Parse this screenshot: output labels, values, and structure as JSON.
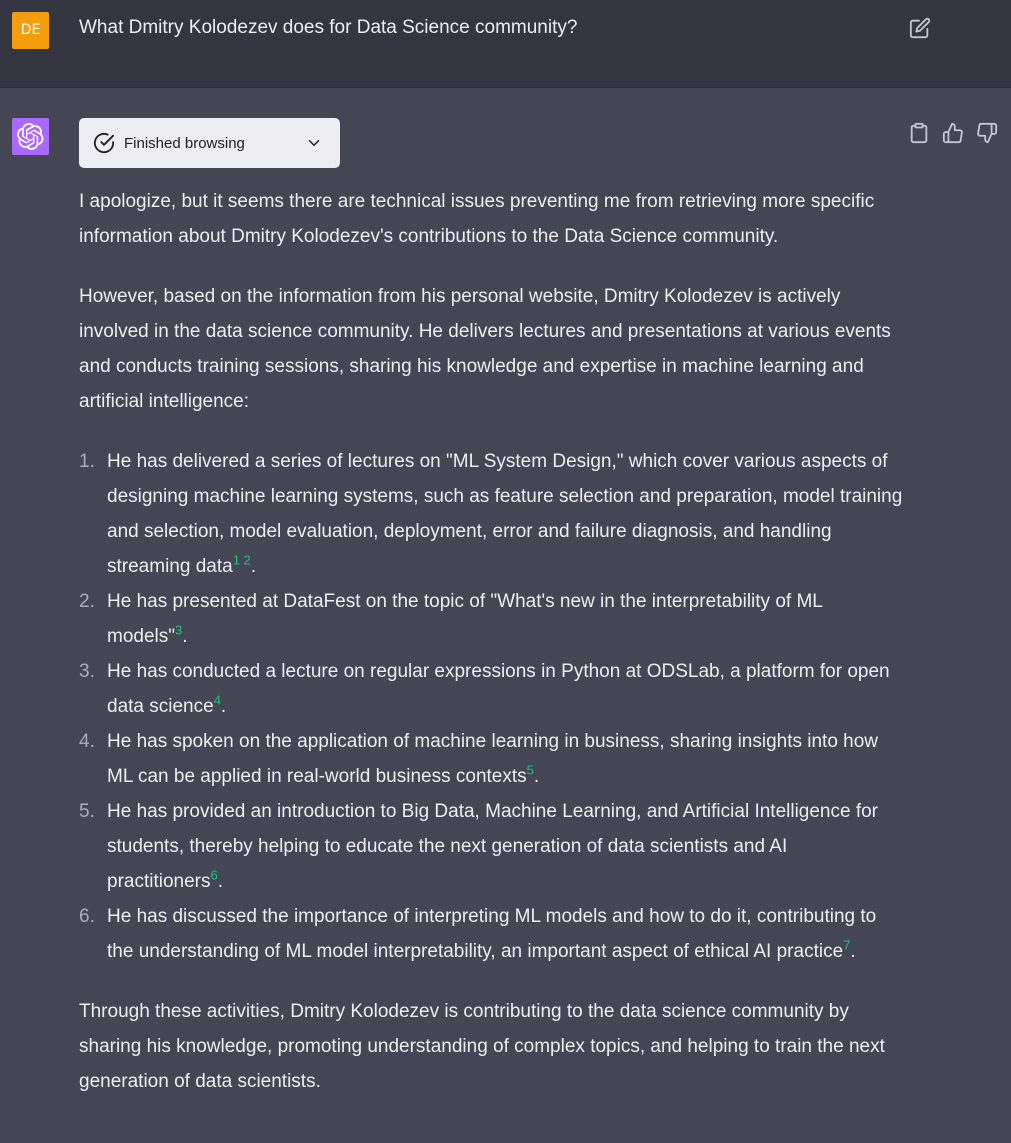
{
  "user": {
    "avatar_initials": "DE",
    "question": "What Dmitry Kolodezev does for Data Science community?"
  },
  "assistant": {
    "browse_label": "Finished browsing",
    "paragraphs": {
      "p1": "I apologize, but it seems there are technical issues preventing me from retrieving more specific information about Dmitry Kolodezev's contributions to the Data Science community.",
      "p2": "However, based on the information from his personal website, Dmitry Kolodezev is actively involved in the data science community. He delivers lectures and presentations at various events and conducts training sessions, sharing his knowledge and expertise in machine learning and artificial intelligence:",
      "p3": "Through these activities, Dmitry Kolodezev is contributing to the data science community by sharing his knowledge, promoting understanding of complex topics, and helping to train the next generation of data scientists."
    },
    "list": [
      {
        "num": "1.",
        "text": "He has delivered a series of lectures on \"ML System Design,\" which cover various aspects of designing machine learning systems, such as feature selection and preparation, model training and selection, model evaluation, deployment, error and failure diagnosis, and handling streaming data",
        "cites": [
          "1",
          "2"
        ],
        "end": "."
      },
      {
        "num": "2.",
        "text": "He has presented at DataFest on the topic of \"What's new in the interpretability of ML models\"",
        "cites": [
          "3"
        ],
        "end": "."
      },
      {
        "num": "3.",
        "text": "He has conducted a lecture on regular expressions in Python at ODSLab, a platform for open data science",
        "cites": [
          "4"
        ],
        "end": "."
      },
      {
        "num": "4.",
        "text": "He has spoken on the application of machine learning in business, sharing insights into how ML can be applied in real-world business contexts",
        "cites": [
          "5"
        ],
        "end": "."
      },
      {
        "num": "5.",
        "text": "He has provided an introduction to Big Data, Machine Learning, and Artificial Intelligence for students, thereby helping to educate the next generation of data scientists and AI practitioners",
        "cites": [
          "6"
        ],
        "end": "."
      },
      {
        "num": "6.",
        "text": "He has discussed the importance of interpreting ML models and how to do it, contributing to the understanding of ML model interpretability, an important aspect of ethical AI practice",
        "cites": [
          "7"
        ],
        "end": "."
      }
    ]
  },
  "colors": {
    "user_bg": "#343541",
    "assistant_bg": "#444654",
    "user_avatar": "#f59e0b",
    "ai_avatar": "#ab68ff",
    "citation": "#19c37d"
  },
  "icons": {
    "edit": "edit-icon",
    "copy": "clipboard-icon",
    "like": "thumbs-up-icon",
    "dislike": "thumbs-down-icon",
    "browse_status": "check-circle-icon",
    "expand": "chevron-down-icon",
    "ai_logo": "openai-logo-icon"
  }
}
